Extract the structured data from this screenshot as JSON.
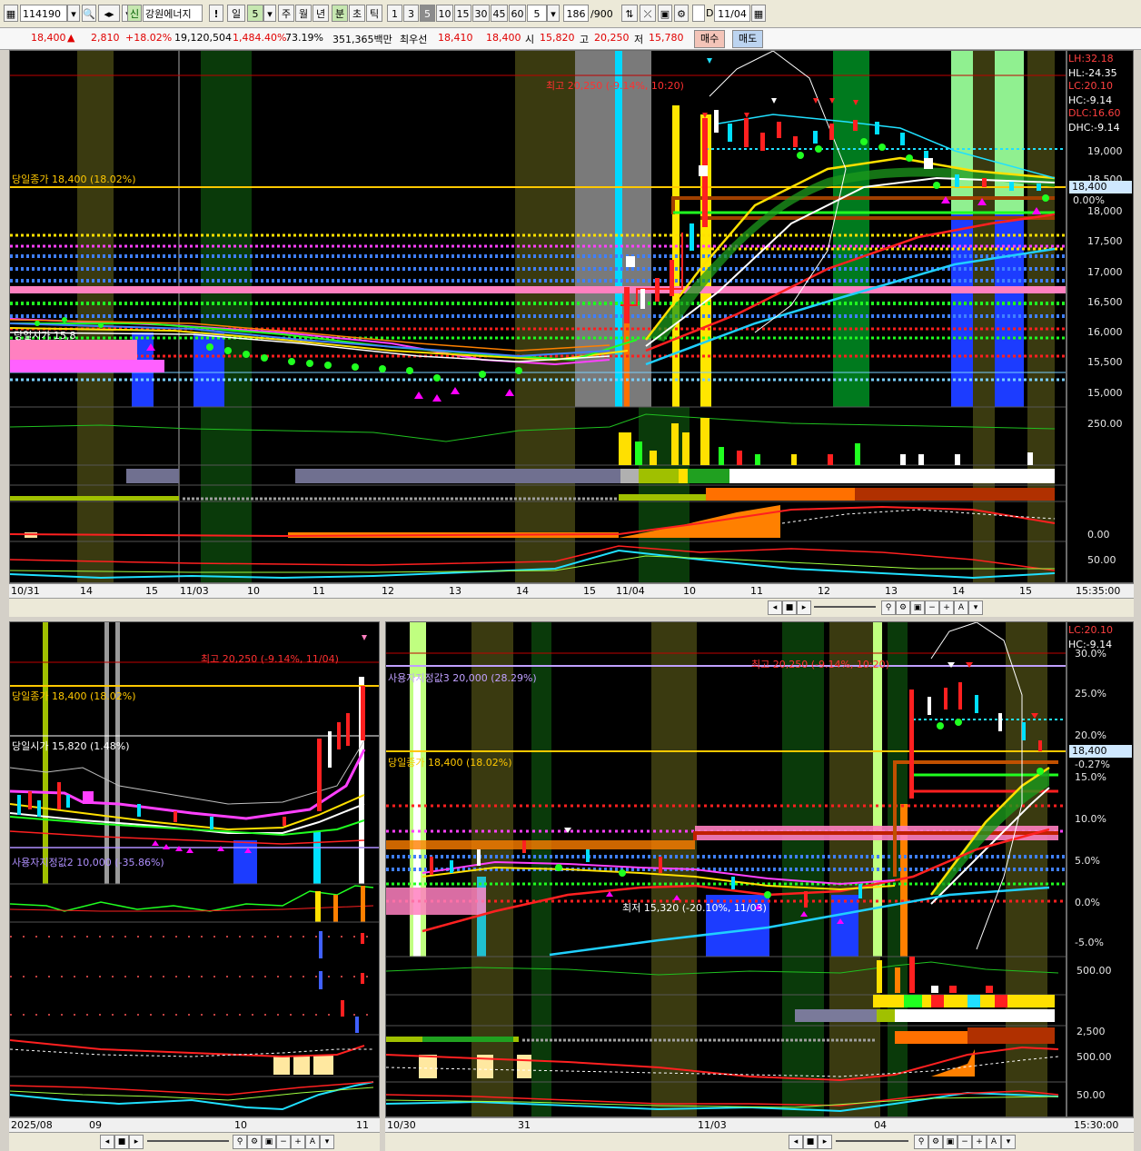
{
  "toolbar": {
    "code": "114190",
    "credit_badge": "신",
    "stock_name": "강원에너지",
    "alert_mark": "!",
    "period_day": "일",
    "period_value": "5",
    "period_week": "주",
    "period_month": "월",
    "period_year": "년",
    "period_minute": "분",
    "period_second": "초",
    "period_tick": "틱",
    "minute_options": [
      "1",
      "3",
      "5",
      "10",
      "15",
      "30",
      "45",
      "60"
    ],
    "minute_selected": "5",
    "interval_value": "5",
    "count_value": "186",
    "count_max": "/900",
    "date_checkbox_label": "D",
    "date_value": "11/04"
  },
  "quote": {
    "price": "18,400",
    "change_arrow": "▲",
    "change": "2,810",
    "change_pct": "+18.02%",
    "volume": "19,120,504",
    "volume_ratio": "1,484.40%",
    "turnover": "73.19%",
    "amount": "351,365백만",
    "best_ask_label": "최우선",
    "best_ask": "18,410",
    "best_bid": "18,400",
    "open_label": "시",
    "open": "15,820",
    "high_label": "고",
    "high": "20,250",
    "low_label": "저",
    "low": "15,780",
    "buy_button": "매수",
    "sell_button": "매도"
  },
  "top_chart": {
    "high_annotation": "최고 20,250 (-9.14%, 10:20)",
    "close_line_label": "당일종가 18,400 (18.02%)",
    "open_line_label": "당일시가 15,8",
    "stats": [
      {
        "label": "LH:32.18",
        "color": "#ff4040"
      },
      {
        "label": "HL:-24.35",
        "color": "#ffffff"
      },
      {
        "label": "LC:20.10",
        "color": "#ff4040"
      },
      {
        "label": "HC:-9.14",
        "color": "#ffffff"
      },
      {
        "label": "DLC:16.60",
        "color": "#ff4040"
      },
      {
        "label": "DHC:-9.14",
        "color": "#ffffff"
      }
    ],
    "price_axis": [
      "19,000",
      "18,500",
      "18,000",
      "17,500",
      "17,000",
      "16,500",
      "16,000",
      "15,500",
      "15,000"
    ],
    "current_price_tag": "18,400",
    "current_pct_tag": "0.00%",
    "volume_axis": "250.00",
    "osc_axis_1": "0.00",
    "osc_axis_2": "50.00",
    "x_labels": [
      "10/31",
      "14",
      "15",
      "11/03",
      "10",
      "11",
      "12",
      "13",
      "14",
      "15",
      "11/04",
      "10",
      "11",
      "12",
      "13",
      "14",
      "15"
    ],
    "time_label": "15:35:00"
  },
  "bottom_left_chart": {
    "high_annotation": "최고 20,250 (-9.14%, 11/04)",
    "close_line_label": "당일종가 18,400 (18.02%)",
    "open_line_label": "당일시가 15,820 (1.48%)",
    "user_line_label": "사용자지정값2 10,000 (-35.86%)",
    "x_labels": [
      "2025/08",
      "09",
      "10",
      "11"
    ]
  },
  "bottom_right_chart": {
    "high_annotation": "최고 20,250 (-9.14%, 10:20)",
    "user_line_label": "사용자지정값3 20,000 (28.29%)",
    "close_line_label": "당일종가 18,400 (18.02%)",
    "low_annotation": "최저 15,320 (-20.10%, 11/03)",
    "stats": [
      {
        "label": "LC:20.10",
        "color": "#ff4040"
      },
      {
        "label": "HC:-9.14",
        "color": "#ffffff"
      }
    ],
    "pct_axis": [
      "30.0%",
      "25.0%",
      "20.0%",
      "15.0%",
      "10.0%",
      "5.0%",
      "0.0%",
      "-5.0%"
    ],
    "current_price_tag": "18,400",
    "current_pct_tag": "-0.27%",
    "volume_axis": "500.00",
    "osc_axis_1": "2,500",
    "osc_axis_2": "500.00",
    "osc_axis_3": "50.00",
    "x_labels": [
      "10/30",
      "31",
      "11/03",
      "04"
    ],
    "time_label": "15:30:00"
  },
  "colors": {
    "background": "#000000",
    "up": "#ff2020",
    "down": "#00e0ff",
    "close_line": "#ffc800",
    "green_band": "#007a1e",
    "olive_band": "#3a3a10",
    "blue_band": "#1c3cff"
  }
}
